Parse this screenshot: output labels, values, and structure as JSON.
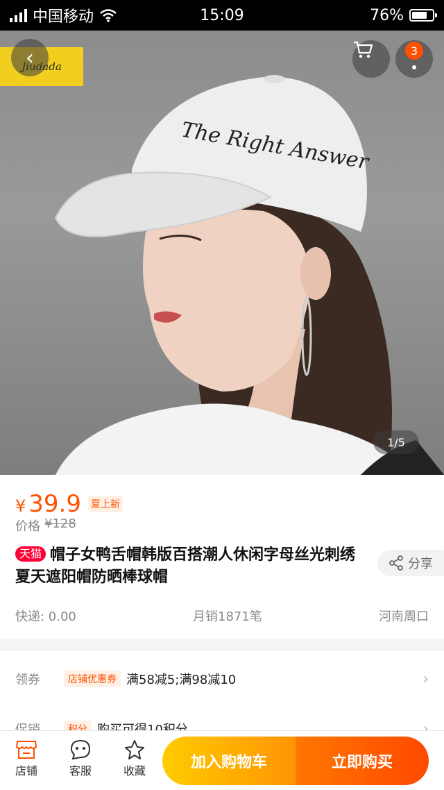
{
  "status_bar": {
    "carrier": "中国移动",
    "time": "15:09",
    "battery": "76%",
    "battery_level": 0.76
  },
  "gallery": {
    "brand_logo_text": "Jiudada",
    "cap_text": "The Right Answer",
    "page_indicator": "1/5",
    "cart_badge": "3"
  },
  "product": {
    "currency": "¥",
    "price": "39.9",
    "promo_tag": "夏上新",
    "orig_label": "价格",
    "orig_price": "¥128",
    "store_badge": "天猫",
    "title": "帽子女鸭舌帽韩版百搭潮人休闲字母丝光刺绣夏天遮阳帽防晒棒球帽",
    "share_label": "分享",
    "shipping": "快递: 0.00",
    "monthly_sales": "月销1871笔",
    "location": "河南周口"
  },
  "coupons": {
    "coupon_label": "领券",
    "coupon_tag": "店铺优惠券",
    "coupon_text": "满58减5;满98减10",
    "promo_label": "促销",
    "promo_tag": "积分",
    "promo_text": "购买可得10积分"
  },
  "bottom_bar": {
    "store": "店铺",
    "service": "客服",
    "favorite": "收藏",
    "add_to_cart": "加入购物车",
    "buy_now": "立即购买"
  },
  "colors": {
    "accent": "#ff5000",
    "tmall_red": "#ff0036",
    "cart_yellow": "#ffcb00",
    "buy_orange": "#ff4900"
  }
}
